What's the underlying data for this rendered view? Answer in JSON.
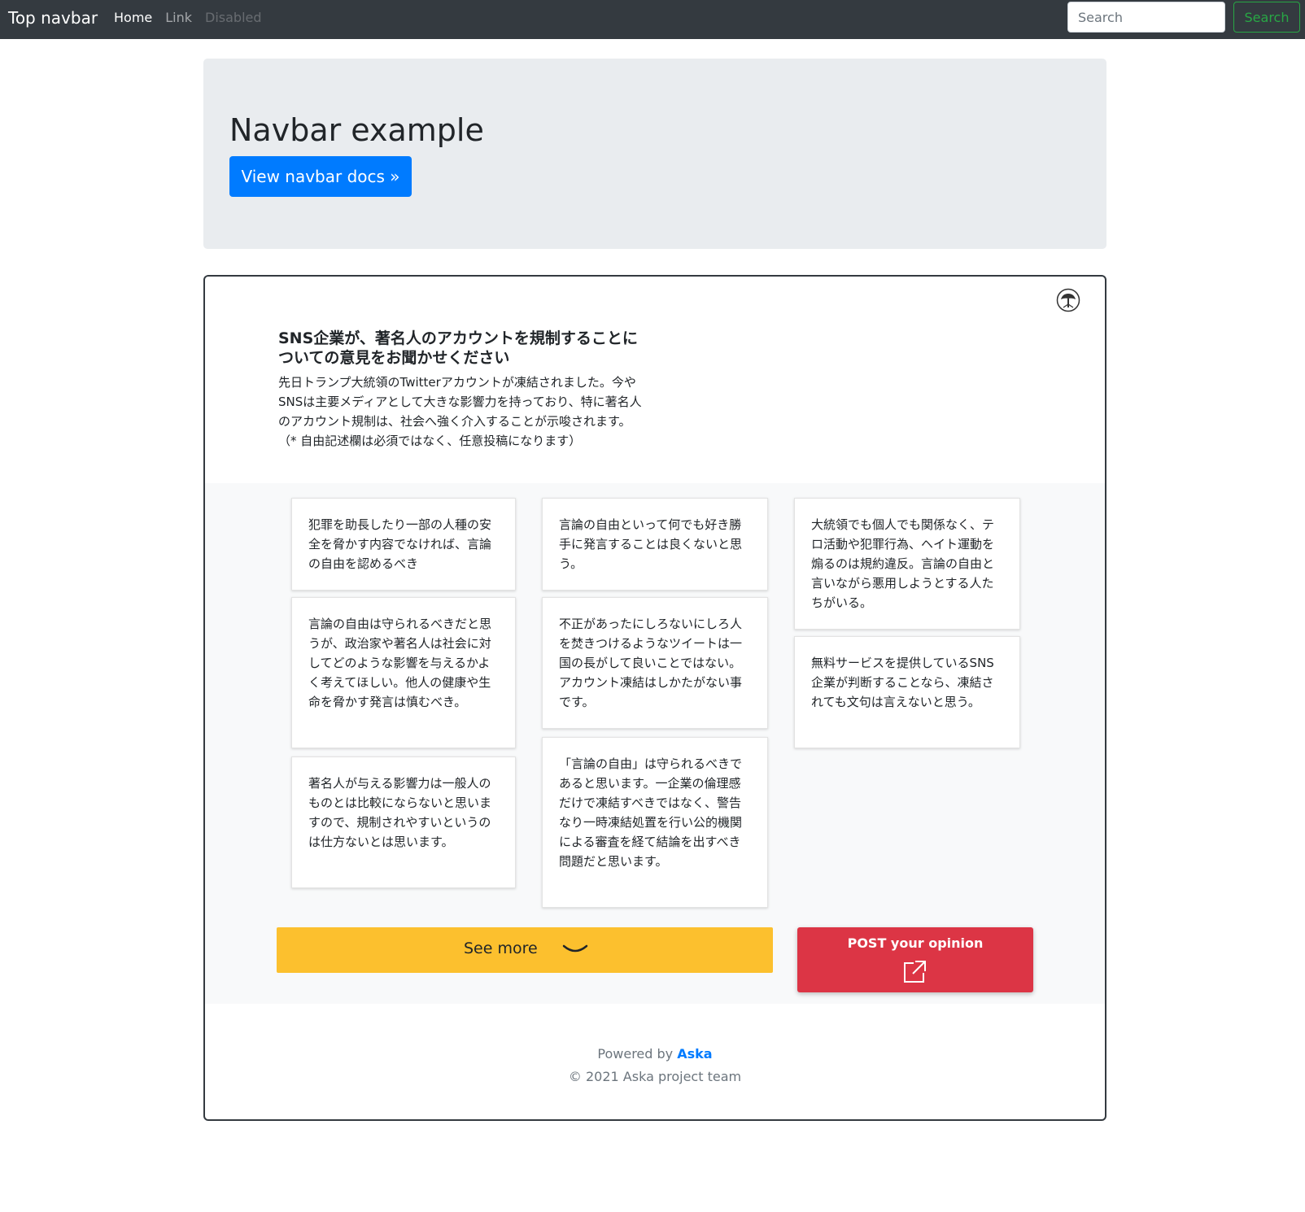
{
  "navbar": {
    "brand": "Top navbar",
    "links": [
      {
        "label": "Home"
      },
      {
        "label": "Link"
      },
      {
        "label": "Disabled"
      }
    ],
    "search_placeholder": "Search",
    "search_button": "Search"
  },
  "jumbotron": {
    "title": "Navbar example",
    "button": "View navbar docs »"
  },
  "widget": {
    "logo_icon": "tree-logo-icon",
    "question_title": "SNS企業が、著名人のアカウントを規制することについての意見をお聞かせください",
    "question_desc": "先日トランプ大統領のTwitterアカウントが凍結されました。今やSNSは主要メディアとして大きな影響力を持っており、特に著名人のアカウント規制は、社会へ強く介入することが示唆されます。 （* 自由記述欄は必須ではなく、任意投稿になります）",
    "opinions": [
      "犯罪を助長したり一部の人種の安全を脅かす内容でなければ、言論の自由を認めるべき",
      "言論の自由は守られるべきだと思うが、政治家や著名人は社会に対してどのような影響を与えるかよく考えてほしい。他人の健康や生命を脅かす発言は慎むべき。",
      "著名人が与える影響力は一般人のものとは比較にならないと思いますので、規制されやすいというのは仕方ないとは思います。",
      "言論の自由といって何でも好き勝手に発言することは良くないと思う。",
      "不正があったにしろないにしろ人を焚きつけるようなツイートは一国の長がして良いことではない。 アカウント凍結はしかたがない事です。",
      "「言論の自由」は守られるべきであると思います。一企業の倫理感だけで凍結すべきではなく、警告なり一時凍結処置を行い公的機関による審査を経て結論を出すべき問題だと思います。",
      "大統領でも個人でも関係なく、テロ活動や犯罪行為、ヘイト運動を煽るのは規約違反。言論の自由と言いながら悪用しようとする人たちがいる。",
      "無料サービスを提供しているSNS企業が判断することなら、凍結されても文句は言えないと思う。"
    ],
    "see_more": "See more",
    "see_more_icon": "chevron-down-icon",
    "post_button": "POST your opinion",
    "post_icon": "external-link-icon",
    "footer": {
      "powered_prefix": "Powered by",
      "powered_link": "Aska",
      "copyright": "© 2021 Aska project team"
    }
  },
  "colors": {
    "navbar_bg": "#343a40",
    "primary": "#007bff",
    "success": "#28a745",
    "warning": "#fcc02e",
    "danger": "#dc3545",
    "jumbotron_bg": "#e9ecef"
  }
}
